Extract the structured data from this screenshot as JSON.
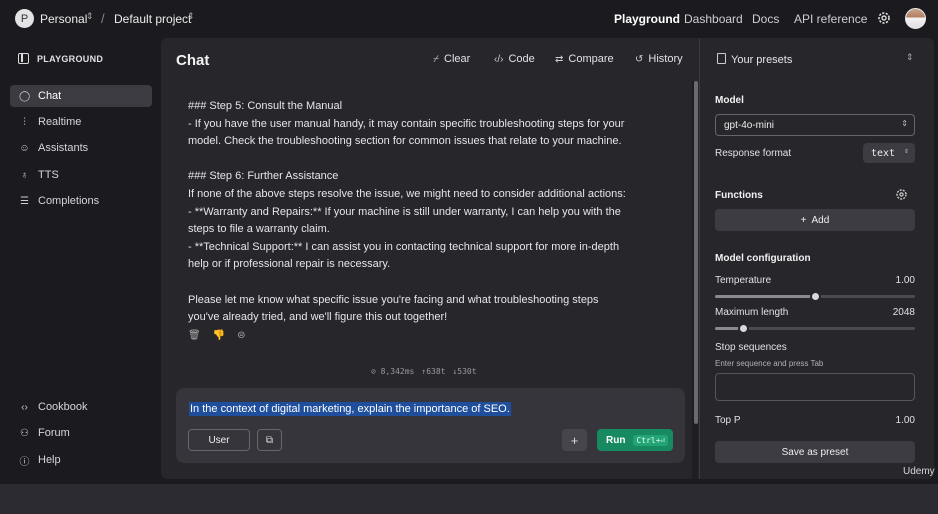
{
  "topbar": {
    "org_initial": "P",
    "org_name": "Personal",
    "separator": "/",
    "project_name": "Default project",
    "nav": [
      "Playground",
      "Dashboard",
      "Docs",
      "API reference"
    ],
    "icons": [
      "gear-icon",
      "user-avatar"
    ]
  },
  "sidebar": {
    "heading": "PLAYGROUND",
    "items": [
      {
        "label": "Chat",
        "icon": "chat-bubble-icon"
      },
      {
        "label": "Realtime",
        "icon": "waveform-icon"
      },
      {
        "label": "Assistants",
        "icon": "assistant-icon"
      },
      {
        "label": "TTS",
        "icon": "microphone-icon"
      },
      {
        "label": "Completions",
        "icon": "lines-icon"
      }
    ],
    "footer": [
      {
        "label": "Cookbook",
        "icon": "code-icon"
      },
      {
        "label": "Forum",
        "icon": "people-icon"
      },
      {
        "label": "Help",
        "icon": "help-icon"
      }
    ]
  },
  "chat": {
    "title": "Chat",
    "toolbar": [
      "Clear",
      "Code",
      "Compare",
      "History"
    ],
    "message_lines": [
      "### Step 5: Consult the Manual",
      "- If you have the user manual handy, it may contain specific troubleshooting steps for your",
      "model. Check the troubleshooting section for common issues that relate to your machine.",
      "",
      "### Step 6: Further Assistance",
      "If none of the above steps resolve the issue, we might need to consider additional actions:",
      "- **Warranty and Repairs:** If your machine is still under warranty, I can help you with the",
      "steps to file a warranty claim.",
      "- **Technical Support:** I can assist you in contacting technical support for more in-depth",
      "help or if professional repair is necessary.",
      "",
      "Please let me know what specific issue you're facing and what troubleshooting steps",
      "you've already tried, and we'll figure this out together!"
    ],
    "stats": {
      "latency": "8,342ms",
      "tokens_in": "638t",
      "tokens_out": "530t"
    },
    "composer": {
      "text": "In the context of digital marketing, explain the importance of SEO.",
      "role": "User",
      "run_label": "Run",
      "run_shortcut": "Ctrl+⏎"
    }
  },
  "settings": {
    "presets_label": "Your presets",
    "model_label": "Model",
    "model_value": "gpt-4o-mini",
    "response_format_label": "Response format",
    "response_format_value": "text",
    "functions_label": "Functions",
    "add_label": "Add",
    "config_label": "Model configuration",
    "temperature_label": "Temperature",
    "temperature_value": "1.00",
    "temperature_fraction": 0.5,
    "max_length_label": "Maximum length",
    "max_length_value": "2048",
    "max_length_fraction": 0.14,
    "stop_label": "Stop sequences",
    "stop_hint": "Enter sequence and press Tab",
    "top_p_label": "Top P",
    "top_p_value": "1.00",
    "save_label": "Save as preset"
  },
  "watermark": "Udemy"
}
